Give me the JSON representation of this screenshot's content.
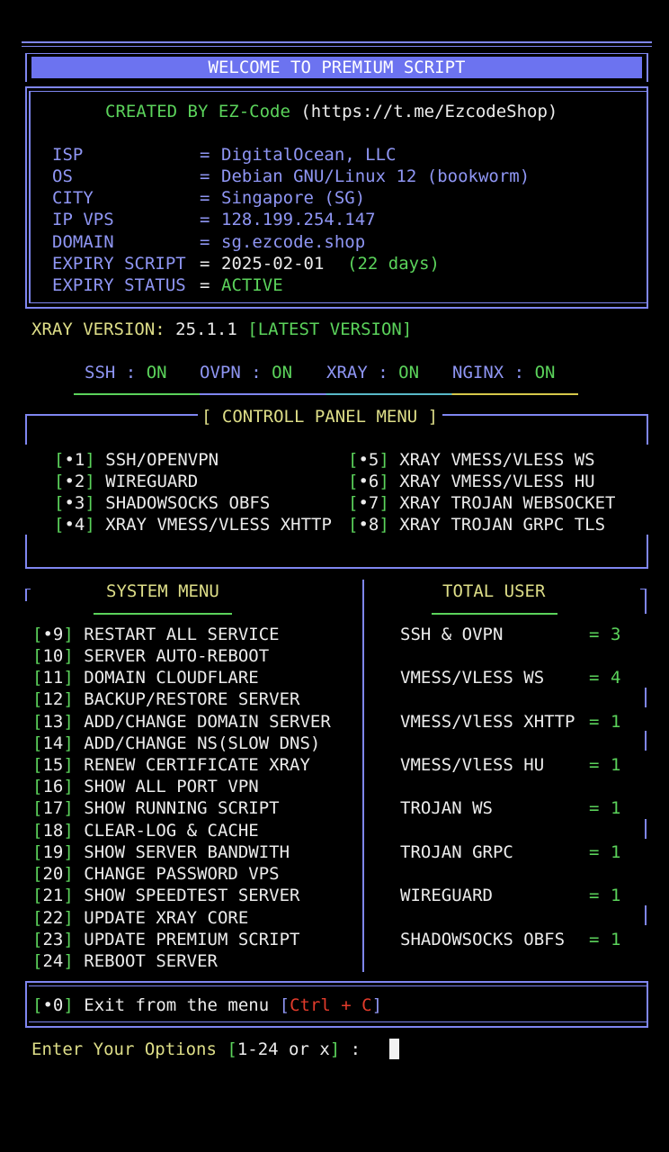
{
  "banner": {
    "title": "WELCOME TO PREMIUM SCRIPT"
  },
  "creator": {
    "prefix": "CREATED BY EZ-Code",
    "link": "(https://t.me/EzcodeShop)"
  },
  "info": [
    {
      "label": "ISP",
      "sep": "=",
      "value": "DigitalOcean, LLC"
    },
    {
      "label": "OS",
      "sep": "=",
      "value": "Debian GNU/Linux 12 (bookworm)"
    },
    {
      "label": "CITY",
      "sep": "=",
      "value": "Singapore (SG)"
    },
    {
      "label": "IP VPS",
      "sep": "=",
      "value": "128.199.254.147"
    },
    {
      "label": "DOMAIN",
      "sep": "=",
      "value": "sg.ezcode.shop"
    },
    {
      "label": "EXPIRY SCRIPT",
      "sep": "=",
      "value": "2025-02-01",
      "extra": "(22 days)"
    },
    {
      "label": "EXPIRY STATUS",
      "sep": "=",
      "value": "ACTIVE"
    }
  ],
  "xray": {
    "label": "XRAY VERSION:",
    "version": "25.1.1",
    "status": "[LATEST VERSION]"
  },
  "services": [
    {
      "name": "SSH",
      "sep": ":",
      "state": "ON"
    },
    {
      "name": "OVPN",
      "sep": ":",
      "state": "ON"
    },
    {
      "name": "XRAY",
      "sep": ":",
      "state": "ON"
    },
    {
      "name": "NGINX",
      "sep": ":",
      "state": "ON"
    }
  ],
  "control_panel": {
    "title": "[ CONTROLL PANEL MENU ]",
    "items": [
      {
        "num": "•1",
        "label": "SSH/OPENVPN"
      },
      {
        "num": "•2",
        "label": "WIREGUARD"
      },
      {
        "num": "•3",
        "label": "SHADOWSOCKS OBFS"
      },
      {
        "num": "•4",
        "label": "XRAY VMESS/VLESS XHTTP"
      },
      {
        "num": "•5",
        "label": "XRAY VMESS/VLESS WS"
      },
      {
        "num": "•6",
        "label": "XRAY VMESS/VLESS HU"
      },
      {
        "num": "•7",
        "label": "XRAY TROJAN WEBSOCKET"
      },
      {
        "num": "•8",
        "label": "XRAY TROJAN GRPC TLS"
      }
    ]
  },
  "system_menu": {
    "title": "SYSTEM MENU",
    "items": [
      {
        "num": "•9",
        "label": "RESTART ALL SERVICE"
      },
      {
        "num": "10",
        "label": "SERVER AUTO-REBOOT"
      },
      {
        "num": "11",
        "label": "DOMAIN CLOUDFLARE"
      },
      {
        "num": "12",
        "label": "BACKUP/RESTORE SERVER"
      },
      {
        "num": "13",
        "label": "ADD/CHANGE DOMAIN SERVER"
      },
      {
        "num": "14",
        "label": "ADD/CHANGE NS(SLOW DNS)"
      },
      {
        "num": "15",
        "label": "RENEW CERTIFICATE XRAY"
      },
      {
        "num": "16",
        "label": "SHOW ALL PORT VPN"
      },
      {
        "num": "17",
        "label": "SHOW RUNNING SCRIPT"
      },
      {
        "num": "18",
        "label": "CLEAR-LOG & CACHE"
      },
      {
        "num": "19",
        "label": "SHOW SERVER BANDWITH"
      },
      {
        "num": "20",
        "label": "CHANGE PASSWORD VPS"
      },
      {
        "num": "21",
        "label": "SHOW SPEEDTEST SERVER"
      },
      {
        "num": "22",
        "label": "UPDATE XRAY CORE"
      },
      {
        "num": "23",
        "label": "UPDATE PREMIUM SCRIPT"
      },
      {
        "num": "24",
        "label": "REBOOT SERVER"
      }
    ]
  },
  "total_user": {
    "title": "TOTAL USER",
    "items": [
      {
        "label": "SSH & OVPN",
        "sep": "=",
        "count": "3"
      },
      {
        "label": "VMESS/VLESS WS",
        "sep": "=",
        "count": "4"
      },
      {
        "label": "VMESS/VlESS XHTTP",
        "sep": "=",
        "count": "1"
      },
      {
        "label": "VMESS/VlESS HU",
        "sep": "=",
        "count": "1"
      },
      {
        "label": "TROJAN WS",
        "sep": "=",
        "count": "1"
      },
      {
        "label": "TROJAN GRPC",
        "sep": "=",
        "count": "1"
      },
      {
        "label": "WIREGUARD",
        "sep": "=",
        "count": "1"
      },
      {
        "label": "SHADOWSOCKS OBFS",
        "sep": "=",
        "count": "1"
      }
    ]
  },
  "exit": {
    "num": "•0",
    "label": "Exit from the menu",
    "keys": "Ctrl + C"
  },
  "prompt": {
    "label": "Enter Your Options",
    "range": "1-24 or x",
    "suffix": ":"
  },
  "colors": {
    "border": "#7f86f0",
    "banner": "#6c73f0",
    "green": "#5bd35b",
    "yellow": "#dede88",
    "red": "#e23b2b"
  }
}
